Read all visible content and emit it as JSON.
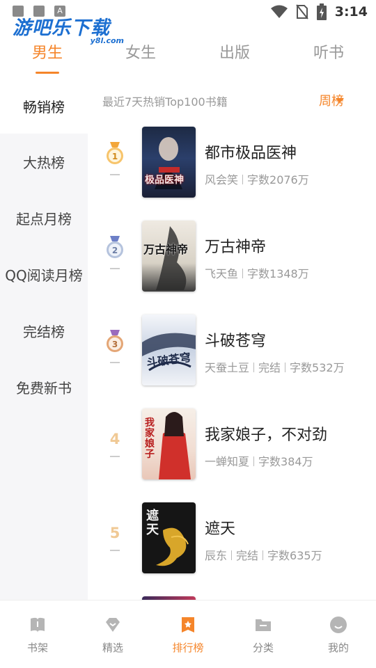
{
  "status_bar": {
    "time": "3:14"
  },
  "watermark": {
    "logo": "游吧乐下载",
    "domain": "y8l.com"
  },
  "top_tabs": [
    {
      "label": "男生",
      "active": true
    },
    {
      "label": "女生",
      "active": false
    },
    {
      "label": "出版",
      "active": false
    },
    {
      "label": "听书",
      "active": false
    }
  ],
  "sidebar": {
    "items": [
      {
        "label": "畅销榜",
        "active": true
      },
      {
        "label": "大热榜",
        "active": false
      },
      {
        "label": "起点月榜",
        "active": false
      },
      {
        "label": "QQ阅读月榜",
        "active": false
      },
      {
        "label": "完结榜",
        "active": false
      },
      {
        "label": "免费新书",
        "active": false
      }
    ]
  },
  "filter": {
    "description": "最近7天热销Top100书籍",
    "selected": "周榜"
  },
  "books": [
    {
      "rank": "1",
      "title": "都市极品医神",
      "author": "风会笑",
      "status": "",
      "words": "字数2076万",
      "cover_text": "极品医神"
    },
    {
      "rank": "2",
      "title": "万古神帝",
      "author": "飞天鱼",
      "status": "",
      "words": "字数1348万",
      "cover_text": "万古神帝"
    },
    {
      "rank": "3",
      "title": "斗破苍穹",
      "author": "天蚕土豆",
      "status": "完结",
      "words": "字数532万",
      "cover_text": "斗破苍穹"
    },
    {
      "rank": "4",
      "title": "我家娘子，不对劲",
      "author": "一蝉知夏",
      "status": "",
      "words": "字数384万",
      "cover_text": "我家娘子"
    },
    {
      "rank": "5",
      "title": "遮天",
      "author": "辰东",
      "status": "完结",
      "words": "字数635万",
      "cover_text": "遮天"
    }
  ],
  "bottom_nav": [
    {
      "label": "书架",
      "icon": "book-icon",
      "active": false
    },
    {
      "label": "精选",
      "icon": "gem-icon",
      "active": false
    },
    {
      "label": "排行榜",
      "icon": "ranking-icon",
      "active": true
    },
    {
      "label": "分类",
      "icon": "folder-icon",
      "active": false
    },
    {
      "label": "我的",
      "icon": "profile-icon",
      "active": false
    }
  ],
  "colors": {
    "accent": "#f5852a",
    "muted": "#999999",
    "sidebar_bg": "#f6f6f8"
  }
}
